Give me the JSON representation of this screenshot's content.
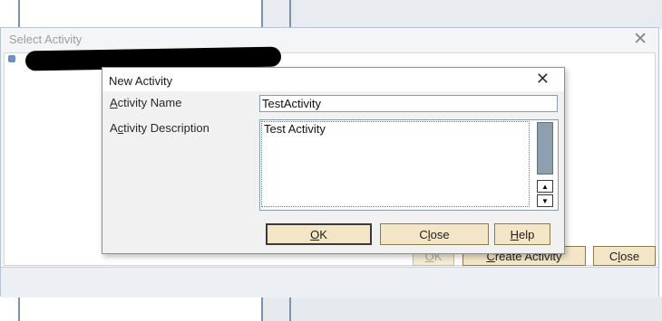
{
  "outer_window": {
    "title": "Select Activity",
    "close_glyph": "✕",
    "buttons": {
      "ok": {
        "prefix": "",
        "mnemonic": "O",
        "rest": "K"
      },
      "create": {
        "prefix": "",
        "mnemonic": "C",
        "rest": "reate Activity"
      },
      "close": {
        "prefix": "C",
        "mnemonic": "l",
        "rest": "ose"
      }
    }
  },
  "dialog": {
    "title": "New Activity",
    "close_glyph": "✕",
    "activity_name_label": {
      "prefix": "",
      "mnemonic": "A",
      "rest": "ctivity Name"
    },
    "activity_name_value": "TestActivity",
    "activity_description_label": {
      "prefix": "A",
      "mnemonic": "c",
      "rest": "tivity Description"
    },
    "activity_description_value": "Test Activity",
    "scroll_up_glyph": "▲",
    "scroll_down_glyph": "▼",
    "buttons": {
      "ok": {
        "prefix": "",
        "mnemonic": "O",
        "rest": "K"
      },
      "close": {
        "prefix": "C",
        "mnemonic": "l",
        "rest": "ose"
      },
      "help": {
        "prefix": "",
        "mnemonic": "H",
        "rest": "elp"
      }
    }
  },
  "colors": {
    "button_bg": "#f2e6c6",
    "scroll_thumb": "#8e9fad",
    "redaction": "#000000"
  }
}
